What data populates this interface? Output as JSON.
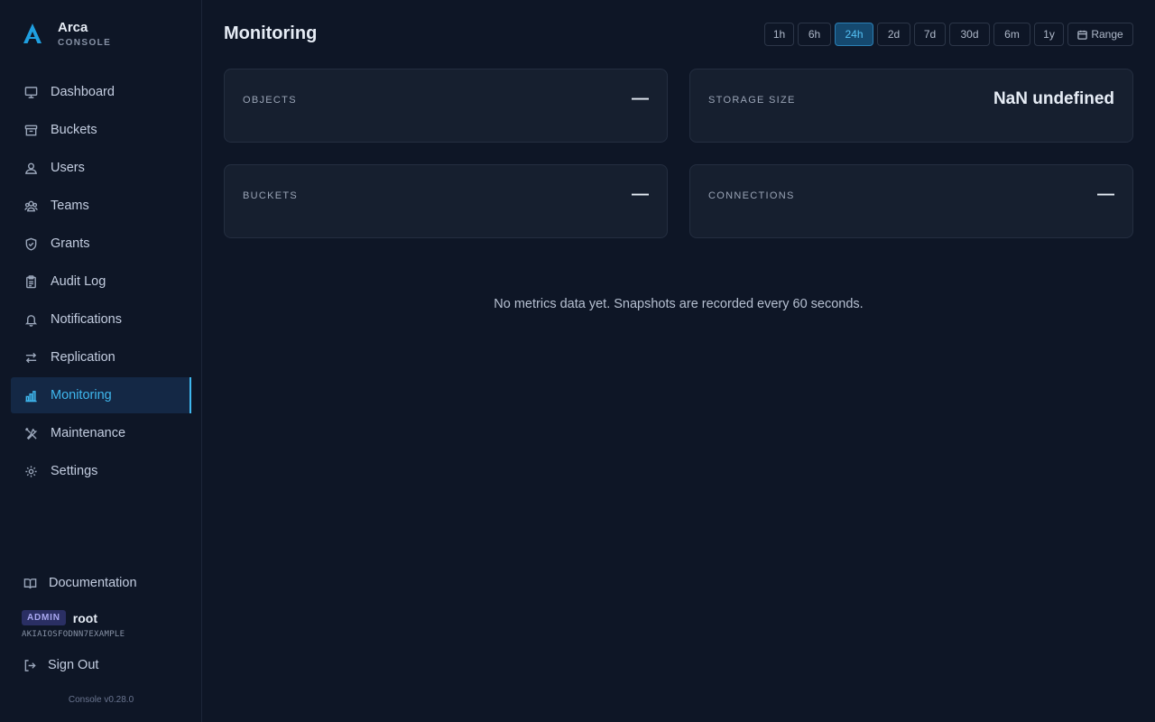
{
  "brand": {
    "name": "Arca",
    "subtitle": "CONSOLE"
  },
  "sidebar": {
    "items": [
      {
        "label": "Dashboard",
        "icon": "monitor-icon"
      },
      {
        "label": "Buckets",
        "icon": "archive-icon"
      },
      {
        "label": "Users",
        "icon": "user-icon"
      },
      {
        "label": "Teams",
        "icon": "users-icon"
      },
      {
        "label": "Grants",
        "icon": "shield-icon"
      },
      {
        "label": "Audit Log",
        "icon": "clipboard-icon"
      },
      {
        "label": "Notifications",
        "icon": "bell-icon"
      },
      {
        "label": "Replication",
        "icon": "arrows-icon"
      },
      {
        "label": "Monitoring",
        "icon": "bar-chart-icon",
        "active": true
      },
      {
        "label": "Maintenance",
        "icon": "tools-icon"
      },
      {
        "label": "Settings",
        "icon": "gear-icon"
      }
    ],
    "documentation": "Documentation",
    "user": {
      "role": "ADMIN",
      "name": "root",
      "access_key": "AKIAIOSFODNN7EXAMPLE"
    },
    "sign_out": "Sign Out",
    "version": "Console v0.28.0"
  },
  "main": {
    "title": "Monitoring",
    "ranges": [
      "1h",
      "6h",
      "24h",
      "2d",
      "7d",
      "30d",
      "6m",
      "1y"
    ],
    "selected_range": "24h",
    "range_button": "Range",
    "cards": [
      {
        "label": "OBJECTS",
        "value": "—"
      },
      {
        "label": "STORAGE SIZE",
        "value": "NaN undefined"
      },
      {
        "label": "BUCKETS",
        "value": "—"
      },
      {
        "label": "CONNECTIONS",
        "value": "—"
      }
    ],
    "empty_message": "No metrics data yet. Snapshots are recorded every 60 seconds."
  },
  "colors": {
    "accent": "#3fb7ee",
    "background": "#0e1626",
    "card": "#161f2f",
    "admin_badge": "#2a2f63"
  }
}
